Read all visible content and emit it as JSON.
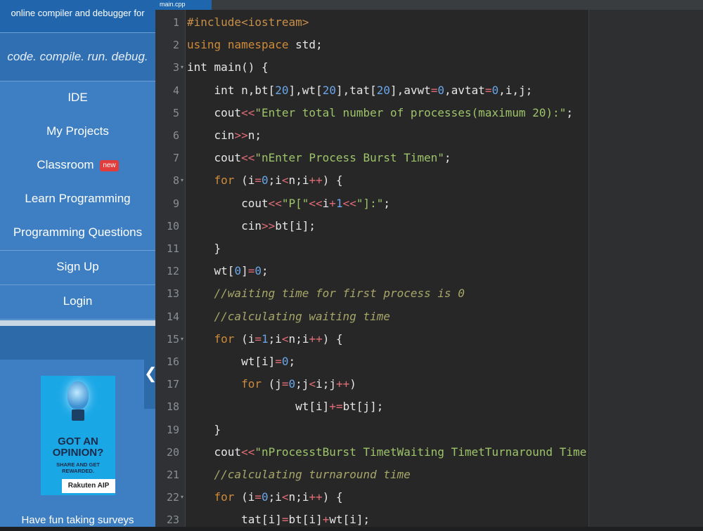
{
  "sidebar": {
    "brand": "online compiler and debugger for c/c++",
    "tagline": "code. compile. run. debug. share.",
    "items": [
      {
        "label": "IDE"
      },
      {
        "label": "My Projects"
      },
      {
        "label": "Classroom",
        "badge": "new"
      },
      {
        "label": "Learn Programming"
      },
      {
        "label": "Programming Questions"
      },
      {
        "label": "Sign Up"
      },
      {
        "label": "Login"
      }
    ],
    "ad": {
      "headline": "GOT AN OPINION?",
      "subline": "SHARE AND GET REWARDED.",
      "logo": "Rakuten AIP"
    },
    "survey_text": "Have fun taking surveys",
    "collapse_glyph": "❮"
  },
  "editor": {
    "tab_label": "main.cpp",
    "lines": [
      {
        "n": "1",
        "code": "#include<iostream>"
      },
      {
        "n": "2",
        "code": "using namespace std;"
      },
      {
        "n": "3",
        "code": "int main() {"
      },
      {
        "n": "4",
        "code": "    int n,bt[20],wt[20],tat[20],avwt=0,avtat=0,i,j;"
      },
      {
        "n": "5",
        "code": "    cout<<\"Enter total number of processes(maximum 20):\";"
      },
      {
        "n": "6",
        "code": "    cin>>n;"
      },
      {
        "n": "7",
        "code": "    cout<<\"nEnter Process Burst Timen\";"
      },
      {
        "n": "8",
        "code": "    for (i=0;i<n;i++) {"
      },
      {
        "n": "9",
        "code": "        cout<<\"P[\"<<i+1<<\"]:\";"
      },
      {
        "n": "10",
        "code": "        cin>>bt[i];"
      },
      {
        "n": "11",
        "code": "    }"
      },
      {
        "n": "12",
        "code": "    wt[0]=0;"
      },
      {
        "n": "13",
        "code": "    //waiting time for first process is 0"
      },
      {
        "n": "14",
        "code": "    //calculating waiting time"
      },
      {
        "n": "15",
        "code": "    for (i=1;i<n;i++) {"
      },
      {
        "n": "16",
        "code": "        wt[i]=0;"
      },
      {
        "n": "17",
        "code": "        for (j=0;j<i;j++)"
      },
      {
        "n": "18",
        "code": "                wt[i]+=bt[j];"
      },
      {
        "n": "19",
        "code": "    }"
      },
      {
        "n": "20",
        "code": "    cout<<\"nProcesstBurst TimetWaiting TimetTurnaround Time\";"
      },
      {
        "n": "21",
        "code": "    //calculating turnaround time"
      },
      {
        "n": "22",
        "code": "    for (i=0;i<n;i++) {"
      },
      {
        "n": "23",
        "code": "        tat[i]=bt[i]+wt[i];"
      }
    ],
    "fold_lines": [
      "3",
      "8",
      "15",
      "22"
    ]
  },
  "colors": {
    "sidebar_bg": "#3d7fc2",
    "brand_bg": "#2166ad",
    "editor_bg": "#272727",
    "keyword": "#cf8b3a",
    "string": "#9ec46a",
    "number": "#6aa6e8",
    "comment": "#a7a76a"
  }
}
